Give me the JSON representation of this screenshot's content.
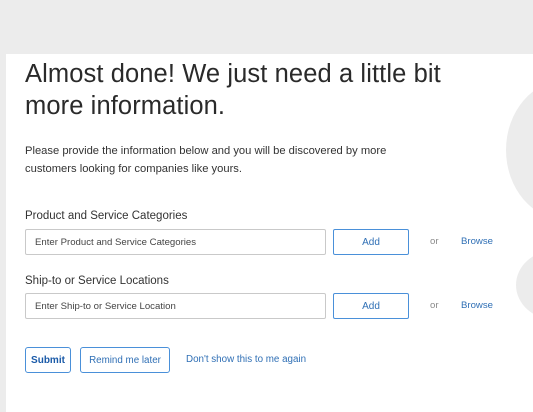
{
  "heading": {
    "title": "Almost done! We just need a little bit more information.",
    "description": "Please provide the information below and you will be discovered by more customers looking for companies like yours."
  },
  "product_section": {
    "label": "Product and Service Categories",
    "input_placeholder": "Enter Product and Service Categories",
    "input_value": "",
    "add_label": "Add",
    "or_text": "or",
    "browse_label": "Browse"
  },
  "ship_section": {
    "label": "Ship-to or Service Locations",
    "input_placeholder": "Enter Ship-to or Service Location",
    "input_value": "",
    "add_label": "Add",
    "or_text": "or",
    "browse_label": "Browse"
  },
  "actions": {
    "submit_label": "Submit",
    "remind_label": "Remind me later",
    "dont_show_label": "Don't show this to me again"
  },
  "colors": {
    "accent": "#2f6fb5",
    "button_border": "#4a90d9",
    "background": "#ececec",
    "panel": "#ffffff"
  }
}
